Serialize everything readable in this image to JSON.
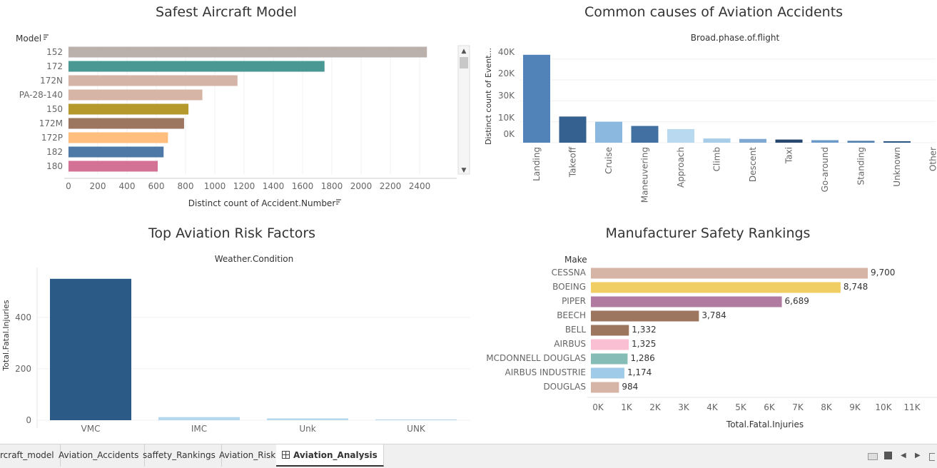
{
  "charts": {
    "model": {
      "title": "Safest Aircraft Model",
      "row_header": "Model",
      "xlabel": "Distinct count of Accident.Number",
      "ticks": [
        0,
        200,
        400,
        600,
        800,
        1000,
        1200,
        1400,
        1600,
        1800,
        2000,
        2200,
        2400
      ]
    },
    "causes": {
      "title": "Common causes of Aviation Accidents",
      "subtitle": "Broad.phase.of.flight",
      "ylabel": "Distinct count of Event...",
      "tick_labels": [
        "0K",
        "10K",
        "30K",
        "20K",
        "40K"
      ]
    },
    "risk": {
      "title": "Top Aviation Risk Factors",
      "subtitle": "Weather.Condition",
      "ylabel": "Total.Fatal.Injuries",
      "ticks": [
        0,
        200,
        400
      ]
    },
    "manufacturer": {
      "title": "Manufacturer Safety Rankings",
      "row_header": "Make",
      "xlabel": "Total.Fatal.Injuries",
      "tick_labels": [
        "0K",
        "1K",
        "2K",
        "3K",
        "4K",
        "5K",
        "6K",
        "7K",
        "8K",
        "9K",
        "10K",
        "11K"
      ]
    }
  },
  "chart_data": [
    {
      "type": "bar",
      "orientation": "horizontal",
      "title": "Safest Aircraft Model",
      "xlabel": "Distinct count of Accident.Number",
      "ylabel": "Model",
      "categories": [
        "152",
        "172",
        "172N",
        "PA-28-140",
        "150",
        "172M",
        "172P",
        "182",
        "180"
      ],
      "values": [
        2450,
        1750,
        1155,
        915,
        820,
        790,
        680,
        650,
        610
      ],
      "colors": [
        "#bab0ac",
        "#499894",
        "#d4b4a6",
        "#d7b5a6",
        "#b6992d",
        "#9d7660",
        "#ffbe7d",
        "#4e79a7",
        "#d37295"
      ],
      "xlim": [
        0,
        2600
      ]
    },
    {
      "type": "bar",
      "title": "Common causes of Aviation Accidents",
      "subtitle": "Broad.phase.of.flight",
      "ylabel": "Distinct count of Event...",
      "categories": [
        "Landing",
        "Takeoff",
        "Cruise",
        "Maneuvering",
        "Approach",
        "Climb",
        "Descent",
        "Taxi",
        "Go-around",
        "Standing",
        "Unknown",
        "Other"
      ],
      "values": [
        42000,
        12500,
        10000,
        8000,
        6500,
        2000,
        1800,
        1500,
        1200,
        900,
        700,
        0
      ],
      "colors": [
        "#5283b8",
        "#34618f",
        "#8bb8de",
        "#4270a2",
        "#b8d9f0",
        "#a7cde9",
        "#7fa9d2",
        "#27476f",
        "#6d9bc9",
        "#5181b0",
        "#2b5a8a",
        "#9fbfe0"
      ],
      "ylim": [
        0,
        45000
      ]
    },
    {
      "type": "bar",
      "title": "Top Aviation Risk Factors",
      "subtitle": "Weather.Condition",
      "ylabel": "Total.Fatal.Injuries",
      "categories": [
        "VMC",
        "IMC",
        "Unk",
        "UNK"
      ],
      "values": [
        550,
        12,
        7,
        3
      ],
      "colors": [
        "#2c5a87",
        "#b6d8ee",
        "#b6d8ee",
        "#b6d8ee"
      ],
      "ylim": [
        0,
        580
      ]
    },
    {
      "type": "bar",
      "orientation": "horizontal",
      "title": "Manufacturer Safety Rankings",
      "xlabel": "Total.Fatal.Injuries",
      "ylabel": "Make",
      "categories": [
        "CESSNA",
        "BOEING",
        "PIPER",
        "BEECH",
        "BELL",
        "AIRBUS",
        "MCDONNELL DOUGLAS",
        "AIRBUS INDUSTRIE",
        "DOUGLAS"
      ],
      "values": [
        9700,
        8748,
        6689,
        3784,
        1332,
        1325,
        1286,
        1174,
        984
      ],
      "value_labels": [
        "9,700",
        "8,748",
        "6,689",
        "3,784",
        "1,332",
        "1,325",
        "1,286",
        "1,174",
        "984"
      ],
      "colors": [
        "#d7b5a6",
        "#f1ce63",
        "#b07aa1",
        "#9d7660",
        "#9d7660",
        "#fabfd2",
        "#86bcb6",
        "#a0cbe8",
        "#d7b5a6"
      ],
      "xlim": [
        0,
        11000
      ]
    }
  ],
  "tabs": [
    {
      "label": "rcraft_model",
      "active": false
    },
    {
      "label": "Aviation_Accidents",
      "active": false
    },
    {
      "label": "saffety_Rankings",
      "active": false
    },
    {
      "label": "Aviation_Risk",
      "active": false
    },
    {
      "label": "Aviation_Analysis",
      "active": true
    }
  ]
}
